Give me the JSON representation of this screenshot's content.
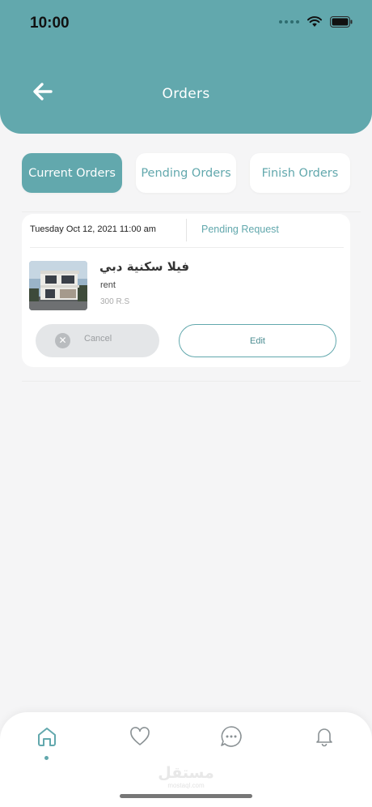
{
  "status_bar": {
    "time": "10:00"
  },
  "header": {
    "title": "Orders",
    "back_icon": "arrow-left-icon"
  },
  "tabs": [
    {
      "label": "Current Orders",
      "active": true
    },
    {
      "label": "Pending Orders",
      "active": false
    },
    {
      "label": "Finish Orders",
      "active": false
    }
  ],
  "order": {
    "date": "Tuesday Oct 12, 2021 11:00 am",
    "status": "Pending Request",
    "name": "فيلا سكنية دبي",
    "type": "rent",
    "price": "300 R.S",
    "cancel_label": "Cancel",
    "edit_label": "Edit"
  },
  "bottom_nav": {
    "items": [
      "home-icon",
      "heart-icon",
      "chat-icon",
      "bell-icon"
    ],
    "active": "home-icon"
  },
  "watermark": {
    "arabic": "مستقل",
    "latin": "mostaql.com"
  },
  "colors": {
    "primary": "#62a8ad",
    "background": "#f5f5f6"
  }
}
